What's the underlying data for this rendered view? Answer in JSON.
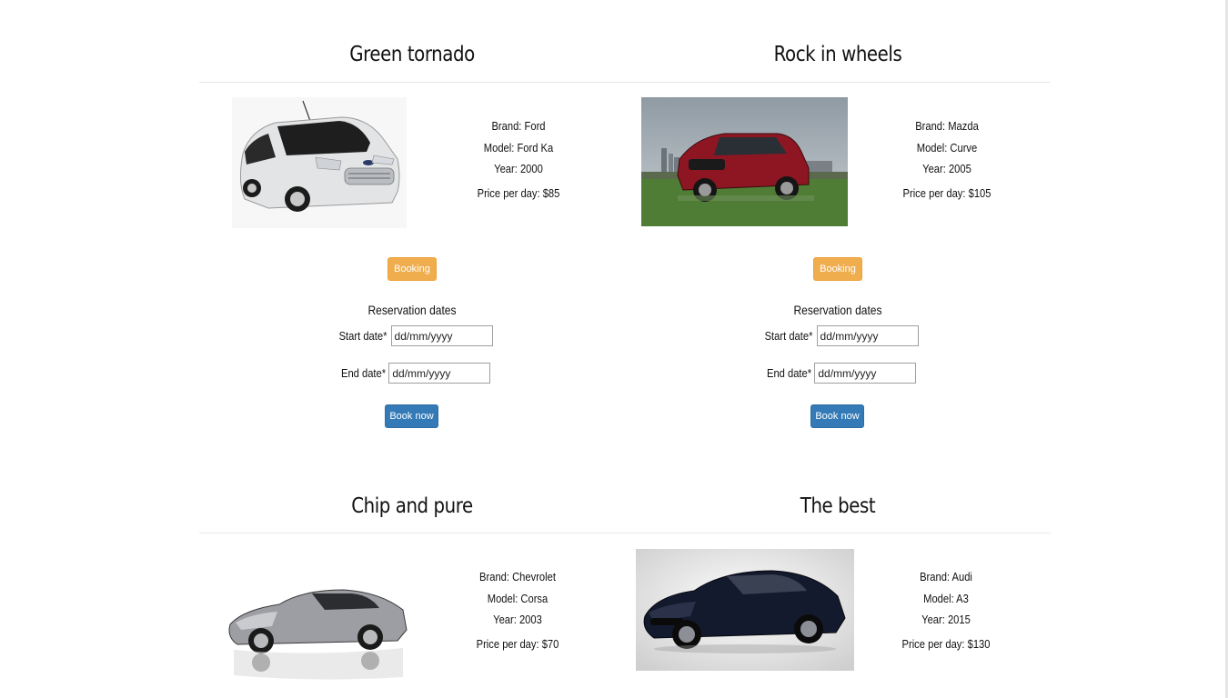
{
  "labels": {
    "brand_prefix": "Brand:",
    "model_prefix": "Model:",
    "year_prefix": "Year:",
    "price_prefix": "Price per day:",
    "booking": "Booking",
    "reservation_dates": "Reservation dates",
    "start_date": "Start date*",
    "end_date": "End date*",
    "date_placeholder": "dd/mm/yyyy",
    "book_now": "Book now"
  },
  "cars": [
    {
      "title": "Green tornado",
      "brand": "Brand: Ford",
      "model": "Model: Ford Ka",
      "year": "Year: 2000",
      "price": "Price per day: $85",
      "photo": "white-sedan-photo"
    },
    {
      "title": "Rock in wheels",
      "brand": "Brand: Mazda",
      "model": "Model: Curve",
      "year": "Year: 2005",
      "price": "Price per day: $105",
      "photo": "red-suv-photo"
    },
    {
      "title": "Chip and pure",
      "brand": "Brand: Chevrolet",
      "model": "Model: Corsa",
      "year": "Year: 2003",
      "price": "Price per day: $70",
      "photo": "silver-roadster-photo"
    },
    {
      "title": "The best",
      "brand": "Brand: Audi",
      "model": "Model: A3",
      "year": "Year: 2015",
      "price": "Price per day: $130",
      "photo": "dark-coupe-photo"
    }
  ],
  "colors": {
    "booking_button": "#f0ad4e",
    "book_now_button": "#337ab7",
    "divider": "#e8e8e8"
  }
}
